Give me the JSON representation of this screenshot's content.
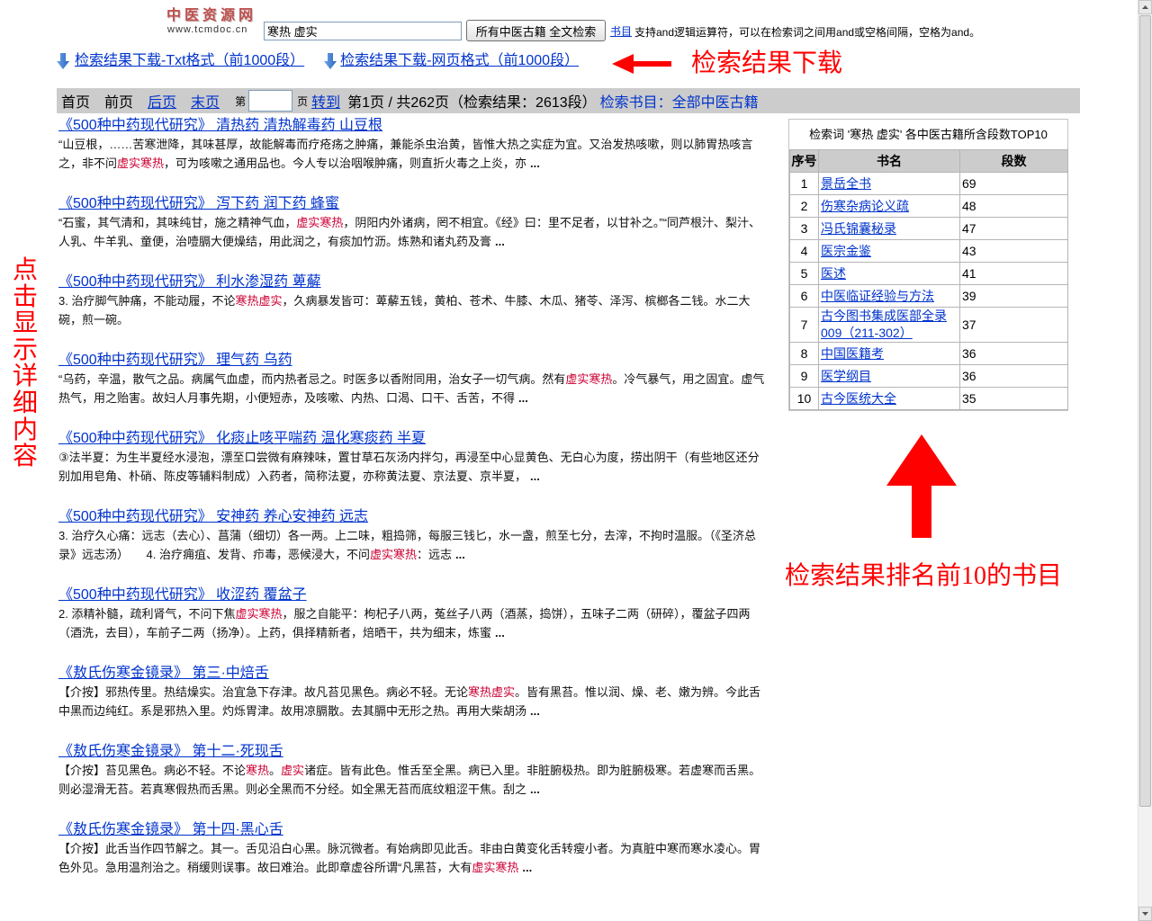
{
  "logo": {
    "name": "中医资源网",
    "domain": "www.tcmdoc.cn"
  },
  "search": {
    "query": "寒热 虚实",
    "button_label": "所有中医古籍 全文检索",
    "catalog_link": "书目",
    "hint": "支持and逻辑运算符，可以在检索词之间用and或空格间隔，空格为and。"
  },
  "downloads": [
    {
      "label": "检索结果下载-Txt格式（前1000段）",
      "icon": "download-arrow-icon"
    },
    {
      "label": "检索结果下载-网页格式（前1000段）",
      "icon": "download-arrow-icon"
    }
  ],
  "callouts": {
    "download": "检索结果下载",
    "details": "点击显示详细内容",
    "top10": "检索结果排名前10的书目"
  },
  "pager": {
    "first": "首页",
    "prev": "前页",
    "next": "后页",
    "last": "末页",
    "page_prefix": "第",
    "page_suffix": "页",
    "goto": "转到",
    "status": "第1页 / 共262页（检索结果：2613段）",
    "scope": "检索书目：全部中医古籍"
  },
  "results": [
    {
      "title": "《500种中药现代研究》 清热药 清热解毒药 山豆根",
      "snippet": [
        {
          "text": "“山豆根，……苦寒泄降，其味甚厚，故能解毒而疗疮疡之肿痛，兼能杀虫治黄，皆惟大热之实症为宜。又治发热咳嗽，则以肺胃热咳言之，非不问"
        },
        {
          "text": "虚实寒热",
          "highlight": true
        },
        {
          "text": "，可为咳嗽之通用品也。今人专以治咽喉肿痛，则直折火毒之上炎，亦"
        }
      ],
      "ellipsis": "..."
    },
    {
      "title": "《500种中药现代研究》 泻下药 润下药 蜂蜜",
      "snippet": [
        {
          "text": "“石蜜，其气清和，其味纯甘，施之精神气血，"
        },
        {
          "text": "虚实寒热",
          "highlight": true
        },
        {
          "text": "，阴阳内外诸病，罔不相宜。《经》曰：里不足者，以甘补之。”“同芦根汁、梨汁、人乳、牛羊乳、童便，治噎膈大便燥结，用此润之，有痰加竹沥。炼熟和诸丸药及膏"
        }
      ],
      "ellipsis": "..."
    },
    {
      "title": "《500种中药现代研究》 利水渗湿药 萆薢",
      "snippet": [
        {
          "text": "3. 治疗脚气肿痛，不能动履，不论"
        },
        {
          "text": "寒热虚实",
          "highlight": true
        },
        {
          "text": "，久病暴发皆可：萆薢五钱，黄柏、苍术、牛膝、木瓜、猪苓、泽泻、槟榔各二钱。水二大碗，煎一碗。"
        }
      ]
    },
    {
      "title": "《500种中药现代研究》 理气药 乌药",
      "snippet": [
        {
          "text": "“乌药，辛温，散气之品。病属气血虚，而内热者忌之。时医多以香附同用，治女子一切气病。然有"
        },
        {
          "text": "虚实寒热",
          "highlight": true
        },
        {
          "text": "。冷气暴气，用之固宜。虚气热气，用之贻害。故妇人月事先期，小便短赤，及咳嗽、内热、口渴、口干、舌苦，不得"
        }
      ],
      "ellipsis": "..."
    },
    {
      "title": "《500种中药现代研究》 化痰止咳平喘药 温化寒痰药 半夏",
      "snippet": [
        {
          "text": "③法半夏：为生半夏经水浸泡，漂至口尝微有麻辣味，置甘草石灰汤内拌匀，再浸至中心显黄色、无白心为度，捞出阴干（有些地区还分别加用皂角、朴硝、陈皮等辅料制成）入药者，简称法夏，亦称黄法夏、京法夏、京半夏，"
        }
      ],
      "ellipsis": "..."
    },
    {
      "title": "《500种中药现代研究》 安神药 养心安神药 远志",
      "snippet": [
        {
          "text": "3. 治疗久心痛：远志（去心）、菖蒲（细切）各一两。上二味，粗捣筛，每服三钱匕，水一盏，煎至七分，去滓，不拘时温服。（《圣济总录》远志汤）　　4. 治疗痈疽、发背、疖毒，恶候浸大，不问"
        },
        {
          "text": "虚实寒热",
          "highlight": true
        },
        {
          "text": "：远志"
        }
      ],
      "ellipsis": "..."
    },
    {
      "title": "《500种中药现代研究》 收涩药 覆盆子",
      "snippet": [
        {
          "text": "2. 添精补髓，疏利肾气，不问下焦"
        },
        {
          "text": "虚实寒热",
          "highlight": true
        },
        {
          "text": "，服之自能平：枸杞子八两，菟丝子八两（酒蒸，捣饼），五味子二两（研碎），覆盆子四两（酒洗，去目），车前子二两（扬净）。上药，俱择精新者，焙晒干，共为细末，炼蜜"
        }
      ],
      "ellipsis": "..."
    },
    {
      "title": "《敖氏伤寒金镜录》 第三·中焙舌",
      "snippet": [
        {
          "text": "【介按】邪热传里。热结燥实。治宜急下存津。故凡苔见黑色。病必不轻。无论"
        },
        {
          "text": "寒热虚实",
          "highlight": true
        },
        {
          "text": "。皆有黑苔。惟以润、燥、老、嫩为辨。今此舌中黑而边纯红。系是邪热入里。灼烁胃津。故用凉膈散。去其膈中无形之热。再用大柴胡汤"
        }
      ],
      "ellipsis": "..."
    },
    {
      "title": "《敖氏伤寒金镜录》 第十二·死现舌",
      "snippet": [
        {
          "text": "【介按】苔见黑色。病必不轻。不论"
        },
        {
          "text": "寒热",
          "highlight": true
        },
        {
          "text": "。"
        },
        {
          "text": "虚实",
          "highlight": true
        },
        {
          "text": "诸症。皆有此色。惟舌至全黑。病已入里。非脏腑极热。即为脏腑极寒。若虚寒而舌黑。则必湿滑无苔。若真寒假热而舌黑。则必全黑而不分经。如全黑无苔而底纹粗涩干焦。刮之"
        }
      ],
      "ellipsis": "..."
    },
    {
      "title": "《敖氏伤寒金镜录》 第十四·黑心舌",
      "snippet": [
        {
          "text": "【介按】此舌当作四节解之。其一。舌见沿白心黑。脉沉微者。有始病即见此舌。非由白黄变化舌转瘦小者。为真脏中寒而寒水凌心。胃色外见。急用温剂治之。稍缓则误事。故曰难治。此即章虚谷所谓“凡黑苔，大有"
        },
        {
          "text": "虚实寒热",
          "highlight": true
        }
      ],
      "ellipsis": "..."
    }
  ],
  "top10": {
    "caption": "检索词 '寒热 虚实' 各中医古籍所含段数TOP10",
    "headers": [
      "序号",
      "书名",
      "段数"
    ],
    "rows": [
      {
        "rank": "1",
        "book": "景岳全书",
        "count": "69"
      },
      {
        "rank": "2",
        "book": "伤寒杂病论义疏",
        "count": "48"
      },
      {
        "rank": "3",
        "book": "冯氏锦囊秘录",
        "count": "47"
      },
      {
        "rank": "4",
        "book": "医宗金鉴",
        "count": "43"
      },
      {
        "rank": "5",
        "book": "医述",
        "count": "41"
      },
      {
        "rank": "6",
        "book": "中医临证经验与方法",
        "count": "39"
      },
      {
        "rank": "7",
        "book": "古今图书集成医部全录009（211-302）",
        "count": "37"
      },
      {
        "rank": "8",
        "book": "中国医籍考",
        "count": "36"
      },
      {
        "rank": "9",
        "book": "医学纲目",
        "count": "36"
      },
      {
        "rank": "10",
        "book": "古今医统大全",
        "count": "35"
      }
    ]
  },
  "colors": {
    "link": "#0033cc",
    "highlight": "#cc0033",
    "callout": "#ff0000",
    "pager_bar": "#cccccc",
    "logo": "#c0504d"
  }
}
